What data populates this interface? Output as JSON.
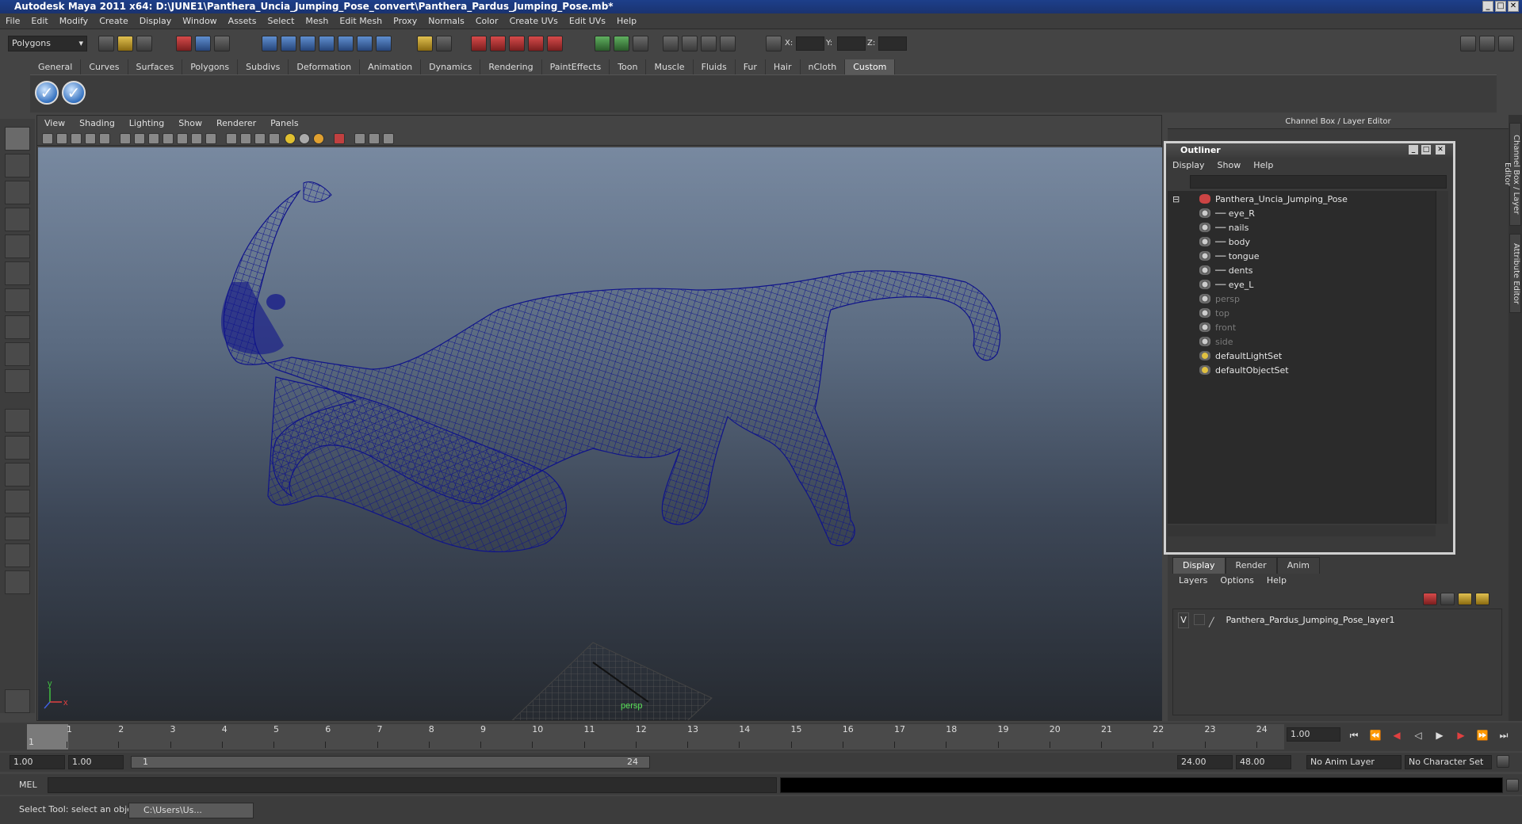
{
  "window": {
    "title": "Autodesk Maya 2011 x64: D:\\JUNE1\\Panthera_Uncia_Jumping_Pose_convert\\Panthera_Pardus_Jumping_Pose.mb*"
  },
  "menubar": [
    "File",
    "Edit",
    "Modify",
    "Create",
    "Display",
    "Window",
    "Assets",
    "Select",
    "Mesh",
    "Edit Mesh",
    "Proxy",
    "Normals",
    "Color",
    "Create UVs",
    "Edit UVs",
    "Help"
  ],
  "statusline": {
    "mode": "Polygons",
    "x_label": "X:",
    "y_label": "Y:",
    "z_label": "Z:"
  },
  "shelf": {
    "tabs": [
      "General",
      "Curves",
      "Surfaces",
      "Polygons",
      "Subdivs",
      "Deformation",
      "Animation",
      "Dynamics",
      "Rendering",
      "PaintEffects",
      "Toon",
      "Muscle",
      "Fluids",
      "Fur",
      "Hair",
      "nCloth",
      "Custom"
    ],
    "active_tab": "Custom"
  },
  "viewport": {
    "menu": [
      "View",
      "Shading",
      "Lighting",
      "Show",
      "Renderer",
      "Panels"
    ],
    "camera_label": "persp",
    "axis_y": "y",
    "axis_x": "x",
    "wireframe_color": "#10148a"
  },
  "channel_box": {
    "title": "Channel Box / Layer Editor"
  },
  "outliner": {
    "title": "Outliner",
    "menu": [
      "Display",
      "Show",
      "Help"
    ],
    "root": "Panthera_Uncia_Jumping_Pose",
    "children": [
      "eye_R",
      "nails",
      "body",
      "tongue",
      "dents",
      "eye_L"
    ],
    "cameras": [
      "persp",
      "top",
      "front",
      "side"
    ],
    "sets": [
      "defaultLightSet",
      "defaultObjectSet"
    ]
  },
  "layer_editor": {
    "tabs": [
      "Display",
      "Render",
      "Anim"
    ],
    "active_tab": "Display",
    "menu": [
      "Layers",
      "Options",
      "Help"
    ],
    "layer_visibility": "V",
    "layer_name": "Panthera_Pardus_Jumping_Pose_layer1"
  },
  "side_tabs": [
    "Channel Box / Layer Editor",
    "Attribute Editor"
  ],
  "timeline": {
    "ticks": [
      "1",
      "2",
      "3",
      "4",
      "5",
      "6",
      "7",
      "8",
      "9",
      "10",
      "11",
      "12",
      "13",
      "14",
      "15",
      "16",
      "17",
      "18",
      "19",
      "20",
      "21",
      "22",
      "23",
      "24"
    ],
    "current_frame_marker": "1",
    "current_time": "1.00"
  },
  "range": {
    "start": "1.00",
    "playback_start": "1.00",
    "slider_start": "1",
    "slider_end": "24",
    "playback_end": "24.00",
    "end": "48.00",
    "anim_layer": "No Anim Layer",
    "character_set": "No Character Set"
  },
  "command": {
    "label": "MEL"
  },
  "help": {
    "text": "Select Tool: select an object",
    "task": "C:\\Users\\Us..."
  }
}
